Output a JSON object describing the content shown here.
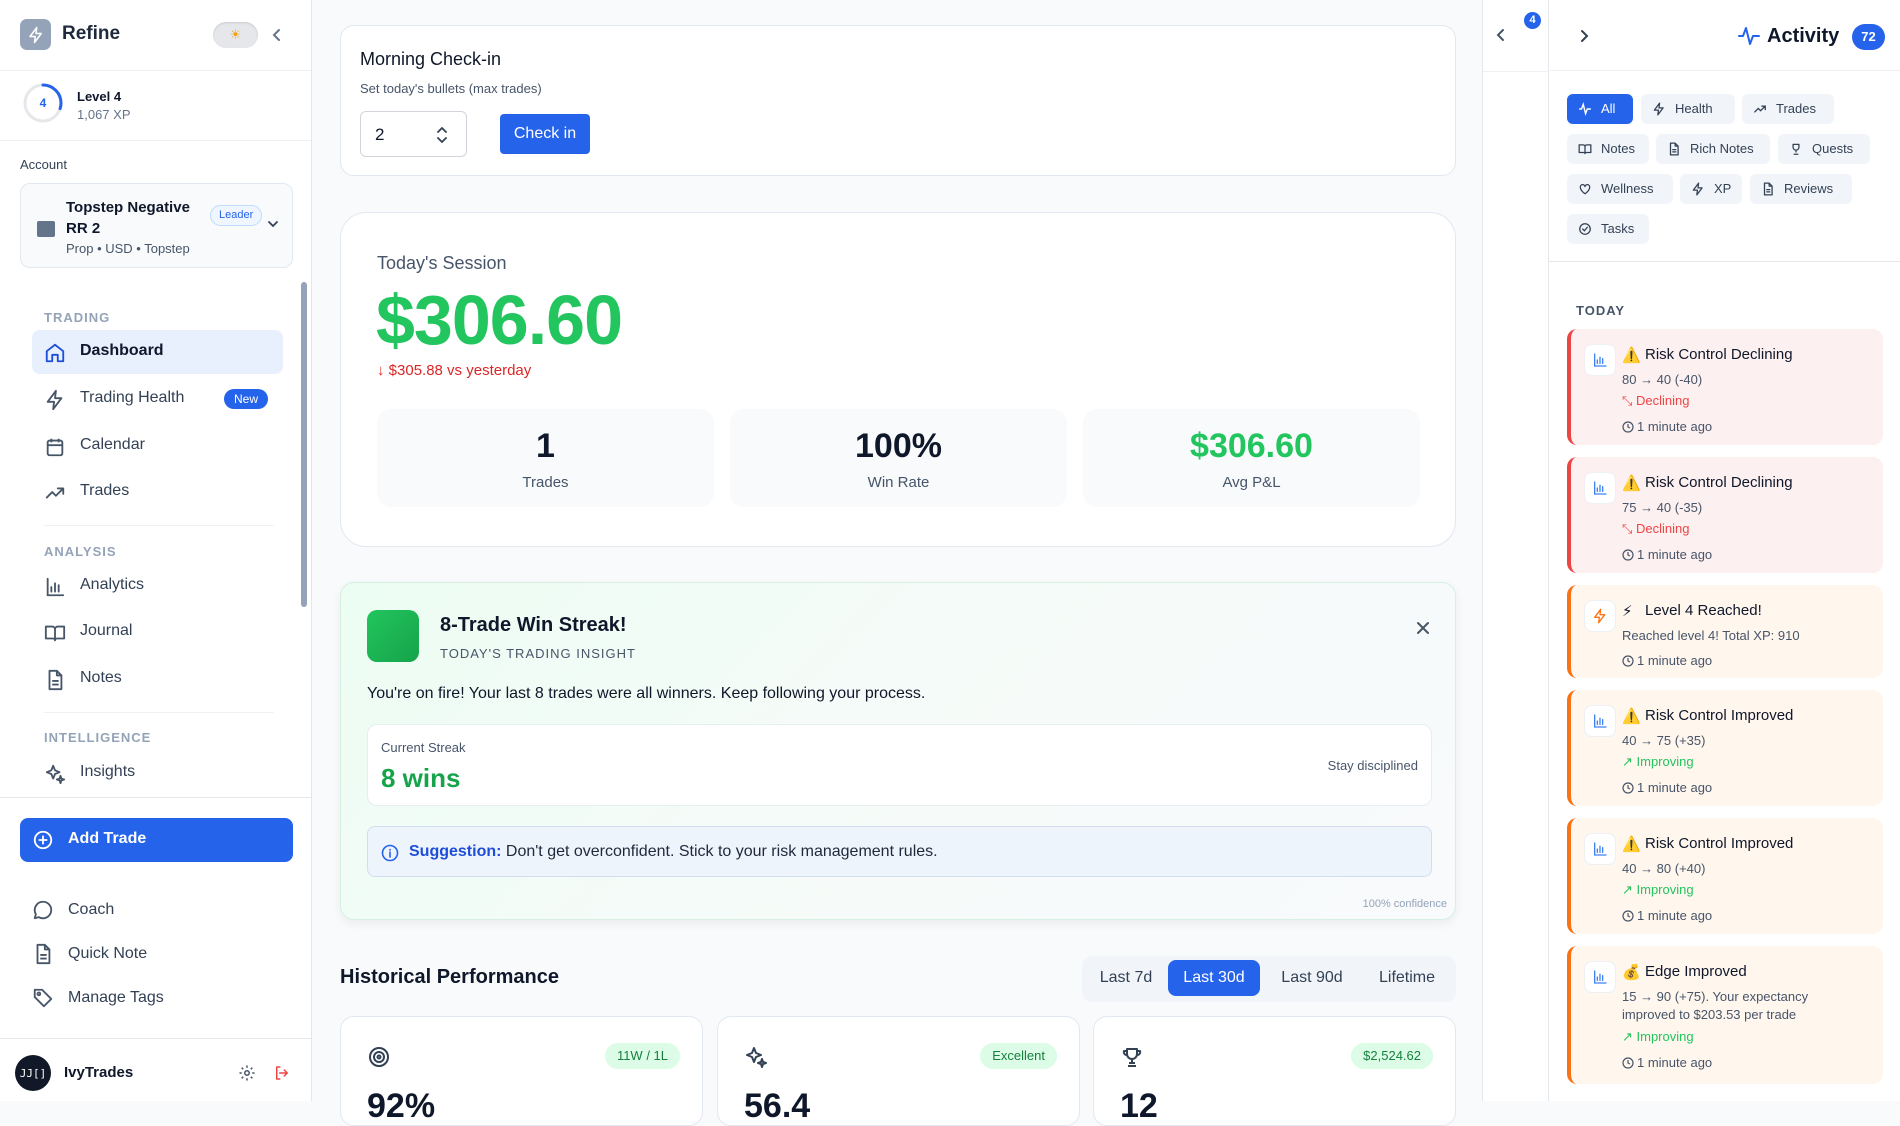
{
  "sidebar": {
    "brand": "Refine",
    "theme_icon": "☀",
    "level": {
      "title": "Level 4",
      "xp": "1,067 XP",
      "num": "4",
      "progress": 0.3
    },
    "account_label": "Account",
    "account": {
      "name": "Topstep Negative RR 2",
      "badge": "Leader",
      "sub": "Prop • USD • Topstep"
    },
    "sections": {
      "trading": "TRADING",
      "analysis": "ANALYSIS",
      "intelligence": "INTELLIGENCE"
    },
    "nav": {
      "dashboard": "Dashboard",
      "trading_health": "Trading Health",
      "trading_health_badge": "New",
      "calendar": "Calendar",
      "trades": "Trades",
      "analytics": "Analytics",
      "journal": "Journal",
      "notes": "Notes",
      "insights": "Insights"
    },
    "add_trade": "Add Trade",
    "coach": "Coach",
    "quick_note": "Quick Note",
    "manage_tags": "Manage Tags",
    "user": {
      "name": "IvyTrades",
      "avatar": "JJ[]"
    }
  },
  "checkin": {
    "title": "Morning Check-in",
    "subtitle": "Set today's bullets (max trades)",
    "value": "2",
    "button": "Check in"
  },
  "session": {
    "title": "Today's Session",
    "amount": "$306.60",
    "delta": "↓ $305.88 vs yesterday",
    "stats": [
      {
        "value": "1",
        "label": "Trades"
      },
      {
        "value": "100%",
        "label": "Win Rate"
      },
      {
        "value": "$306.60",
        "label": "Avg P&L"
      }
    ]
  },
  "insight": {
    "title": "8-Trade Win Streak!",
    "subtitle": "TODAY'S TRADING INSIGHT",
    "body": "You're on fire! Your last 8 trades were all winners. Keep following your process.",
    "streak_label": "Current Streak",
    "streak_value": "8 wins",
    "streak_note": "Stay disciplined",
    "suggestion_label": "Suggestion:",
    "suggestion_text": "Don't get overconfident. Stick to your risk management rules.",
    "confidence": "100% confidence"
  },
  "historical": {
    "title": "Historical Performance",
    "tabs": [
      "Last 7d",
      "Last 30d",
      "Last 90d",
      "Lifetime"
    ],
    "active_tab": "Last 30d",
    "cards": [
      {
        "icon": "target-icon",
        "badge": "11W / 1L",
        "value": "92%"
      },
      {
        "icon": "sparkles-icon",
        "badge": "Excellent",
        "value": "56.4"
      },
      {
        "icon": "trophy-icon",
        "badge": "$2,524.62",
        "value": "12"
      }
    ]
  },
  "strip": {
    "badge": "4"
  },
  "activity": {
    "title": "Activity",
    "count": "72",
    "filters": [
      "All",
      "Health",
      "Trades",
      "Notes",
      "Rich Notes",
      "Quests",
      "Wellness",
      "XP",
      "Reviews",
      "Tasks"
    ],
    "active_filter": "All",
    "today_label": "TODAY",
    "entries": [
      {
        "emoji": "⚠️",
        "title": "Risk Control Declining",
        "desc": "80 → 40 (-40)",
        "trend": "Declining",
        "time": "1 minute ago",
        "tone": "red"
      },
      {
        "emoji": "⚠️",
        "title": "Risk Control Declining",
        "desc": "75 → 40 (-35)",
        "trend": "Declining",
        "time": "1 minute ago",
        "tone": "red"
      },
      {
        "emoji": "⚡",
        "title": "Level 4 Reached!",
        "desc": "Reached level 4! Total XP: 910",
        "trend": "",
        "time": "1 minute ago",
        "tone": "orange"
      },
      {
        "emoji": "⚠️",
        "title": "Risk Control Improved",
        "desc": "40 → 75 (+35)",
        "trend": "Improving",
        "time": "1 minute ago",
        "tone": "orange"
      },
      {
        "emoji": "⚠️",
        "title": "Risk Control Improved",
        "desc": "40 → 80 (+40)",
        "trend": "Improving",
        "time": "1 minute ago",
        "tone": "orange"
      },
      {
        "emoji": "💰",
        "title": "Edge Improved",
        "desc": "15 → 90 (+75). Your expectancy improved to $203.53 per trade",
        "trend": "Improving",
        "time": "1 minute ago",
        "tone": "orange"
      }
    ]
  },
  "colors": {
    "accent": "#2563eb",
    "profit": "#22c55e",
    "loss": "#dc2626",
    "warn": "#f97316"
  }
}
